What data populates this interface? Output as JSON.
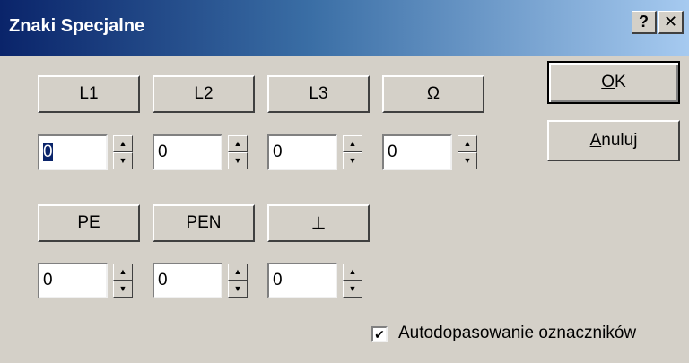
{
  "window": {
    "title": "Znaki Specjalne",
    "help_label": "?",
    "close_label": "✕"
  },
  "row1": [
    {
      "label": "L1",
      "value": "0"
    },
    {
      "label": "L2",
      "value": "0"
    },
    {
      "label": "L3",
      "value": "0"
    },
    {
      "label": "Ω",
      "value": "0"
    }
  ],
  "row2": [
    {
      "label": "PE",
      "value": "0"
    },
    {
      "label": "PEN",
      "value": "0"
    },
    {
      "label": "⊥",
      "value": "0"
    }
  ],
  "buttons": {
    "ok_underline": "O",
    "ok_rest": "K",
    "cancel_underline": "A",
    "cancel_rest": "nuluj"
  },
  "autofit": {
    "checked": true,
    "check_mark": "✔",
    "label": "Autodopasowanie oznaczników"
  },
  "spin_arrows": {
    "up": "▲",
    "down": "▼"
  }
}
